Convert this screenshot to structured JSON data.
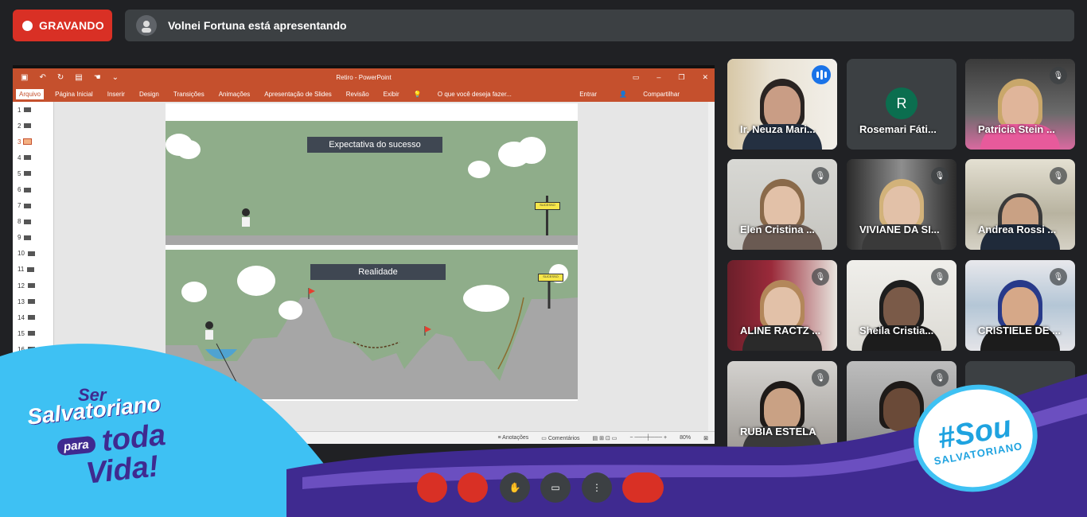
{
  "recording": {
    "label": "GRAVANDO"
  },
  "presenter": {
    "text": "Volnei Fortuna está apresentando"
  },
  "ppt": {
    "window_title": "Retiro - PowerPoint",
    "ribbon_tabs": [
      "Arquivo",
      "Página Inicial",
      "Inserir",
      "Design",
      "Transições",
      "Animações",
      "Apresentação de Slides",
      "Revisão",
      "Exibir"
    ],
    "tell_me": "O que você deseja fazer...",
    "signin": "Entrar",
    "share": "Compartilhar",
    "slide_numbers": [
      "1",
      "2",
      "3",
      "4",
      "5",
      "6",
      "7",
      "8",
      "9",
      "10",
      "11",
      "12",
      "13",
      "14",
      "15",
      "16"
    ],
    "active_slide": "3",
    "slide": {
      "heading_top": "Expectativa do sucesso",
      "heading_bottom": "Realidade",
      "sign_text": "SUCESSO"
    },
    "status": {
      "notes": "Anotações",
      "comments": "Comentários",
      "zoom": "80%"
    }
  },
  "participants": [
    {
      "name": "Ir. Neuza Mari...",
      "speaking": true
    },
    {
      "name": "Rosemari Fáti...",
      "initial": "R"
    },
    {
      "name": "Patricia Stein ..."
    },
    {
      "name": "Elen Cristina ..."
    },
    {
      "name": "VIVIANE DA SI..."
    },
    {
      "name": "Andrea Rossi ..."
    },
    {
      "name": "ALINE RACTZ ..."
    },
    {
      "name": "Sheila Cristia..."
    },
    {
      "name": "CRISTIELE DE ..."
    },
    {
      "name": "RUBIA ESTELA"
    }
  ],
  "branding": {
    "slogan_ser": "Ser",
    "slogan_salvatoriano": "Salvatoriano",
    "slogan_para": "para",
    "slogan_toda": "toda",
    "slogan_vida": "Vida!",
    "badge_hash": "#Sou",
    "badge_word": "SALVATORIANO"
  },
  "colors": {
    "accent": "#d93025",
    "ppt": "#c5502d",
    "speak": "#1a73e8",
    "wave_blue": "#3ec1f3",
    "wave_purple": "#3f2a90"
  }
}
